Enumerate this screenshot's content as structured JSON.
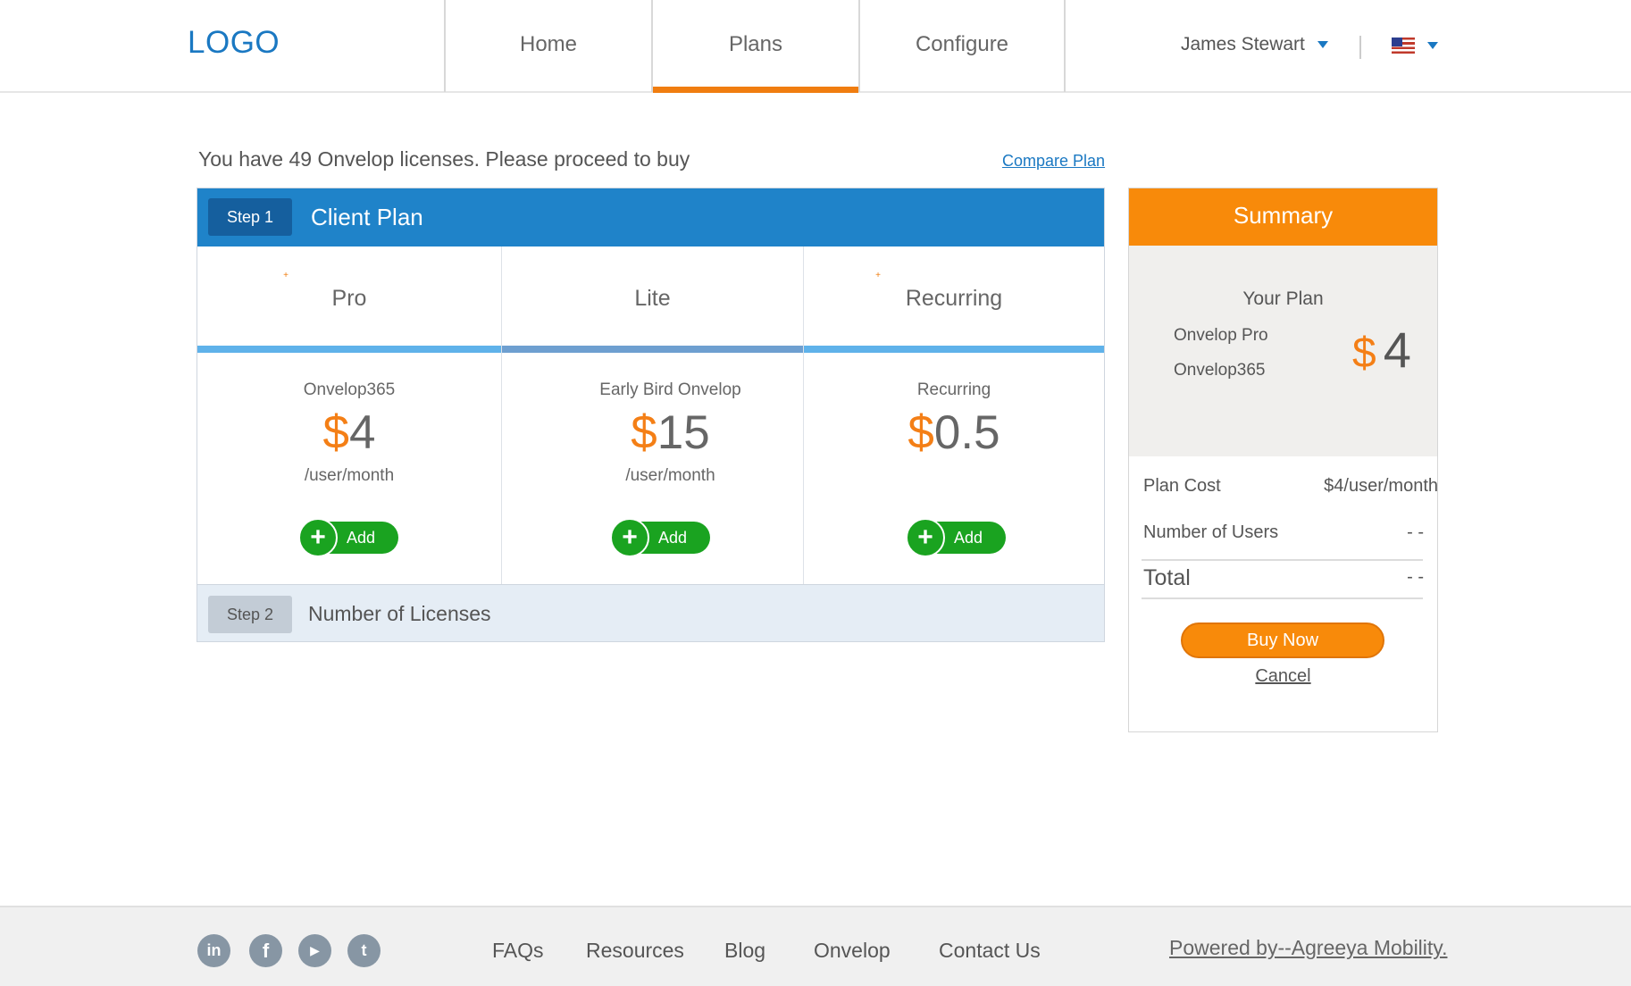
{
  "header": {
    "logo": "LOGO",
    "nav": [
      {
        "label": "Home"
      },
      {
        "label": "Plans",
        "active": true
      },
      {
        "label": "Configure"
      }
    ],
    "user_name": "James Stewart",
    "language_flag": "us-flag-icon"
  },
  "intro": {
    "text": "You have 49 Onvelop licenses. Please proceed to buy",
    "compare_link": "Compare Plan"
  },
  "step1": {
    "badge": "Step 1",
    "title": "Client Plan"
  },
  "plans": [
    {
      "name": "Pro",
      "sub": "Onvelop365",
      "currency": "$",
      "price": "4",
      "unit": "/user/month",
      "add_label": "Add"
    },
    {
      "name": "Lite",
      "sub": "Early Bird Onvelop",
      "currency": "$",
      "price": "15",
      "unit": "/user/month",
      "add_label": "Add"
    },
    {
      "name": "Recurring",
      "sub": "Recurring",
      "currency": "$",
      "price": "0.5",
      "unit": "",
      "add_label": "Add"
    }
  ],
  "step2": {
    "badge": "Step 2",
    "title": "Number of Licenses"
  },
  "summary": {
    "title": "Summary",
    "your_plan_label": "Your Plan",
    "plan_line1": "Onvelop Pro",
    "plan_line2": "Onvelop365",
    "currency": "$",
    "price": "4",
    "plan_cost_label": "Plan Cost",
    "plan_cost_value": "$4/user/month",
    "users_label": "Number of Users",
    "users_value": "- -",
    "total_label": "Total",
    "total_value": "- -",
    "buy_label": "Buy Now",
    "cancel_label": "Cancel"
  },
  "footer": {
    "social": [
      {
        "icon": "linkedin-icon",
        "glyph": "in"
      },
      {
        "icon": "facebook-icon",
        "glyph": "f"
      },
      {
        "icon": "youtube-icon",
        "glyph": "▶"
      },
      {
        "icon": "twitter-icon",
        "glyph": "t"
      }
    ],
    "links": [
      "FAQs",
      "Resources",
      "Blog",
      "Onvelop",
      "Contact Us"
    ],
    "powered": "Powered by--Agreeya Mobility."
  },
  "colors": {
    "brand_blue": "#1f83c9",
    "accent_orange": "#f88a0a",
    "add_green": "#1aa320"
  }
}
